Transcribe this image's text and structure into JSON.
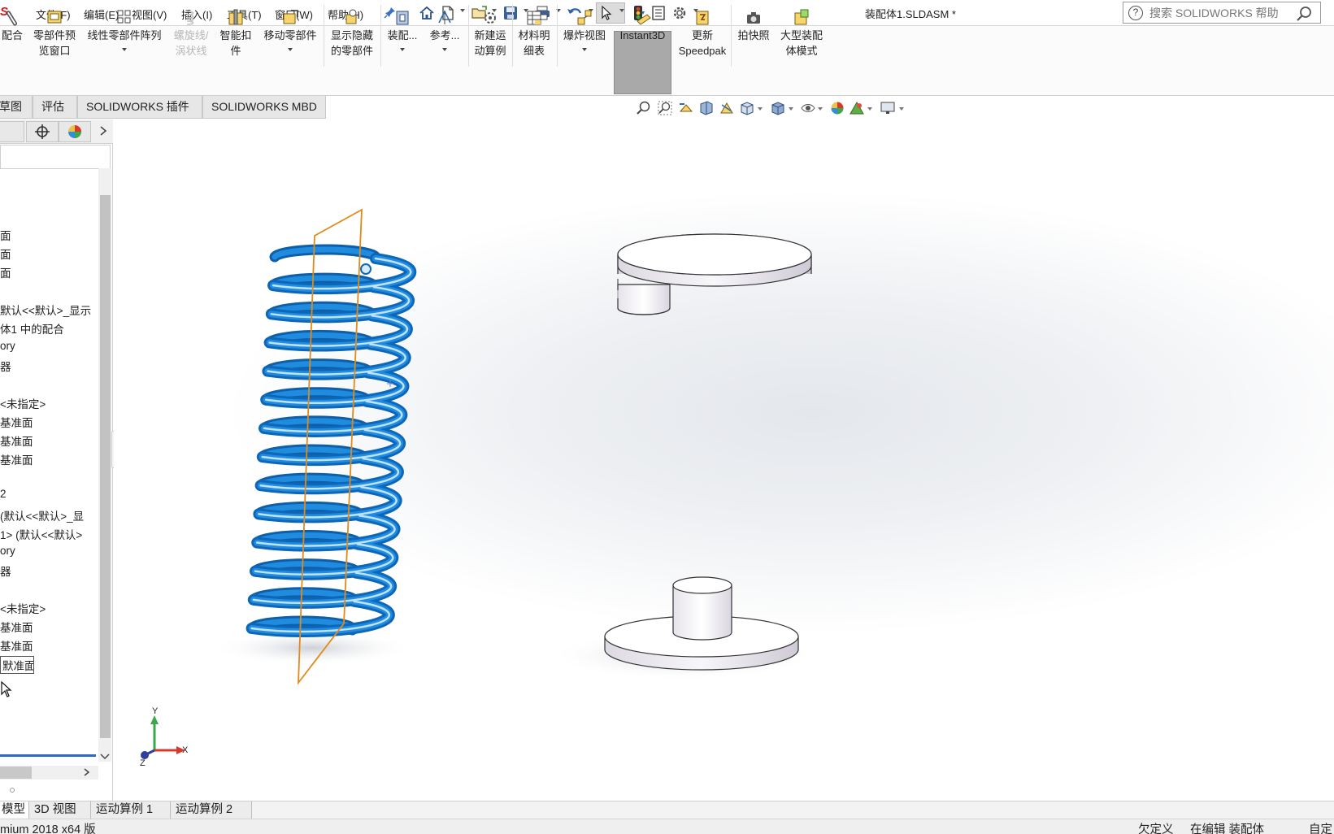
{
  "app": {
    "logo": "S",
    "title": "装配体1.SLDASM *"
  },
  "menu": [
    "文件(F)",
    "编辑(E)",
    "视图(V)",
    "插入(I)",
    "工具(T)",
    "窗口(W)",
    "帮助(H)"
  ],
  "help_search": {
    "placeholder": "搜索 SOLIDWORKS 帮助"
  },
  "ribbon": {
    "mate": "配合",
    "preview_1": "零部件预",
    "preview_2": "览窗口",
    "linear_pattern": "线性零部件阵列",
    "helix_1": "螺旋线/",
    "helix_2": "涡状线",
    "smart_1": "智能扣",
    "smart_2": "件",
    "move": "移动零部件",
    "show_hidden_1": "显示隐藏",
    "show_hidden_2": "的零部件",
    "assembly": "装配...",
    "reference": "参考...",
    "motion_1": "新建运",
    "motion_2": "动算例",
    "bom_1": "材料明",
    "bom_2": "细表",
    "explode": "爆炸视图",
    "instant3d": "Instant3D",
    "speedpak_1": "更新",
    "speedpak_2": "Speedpak",
    "snapshot": "拍快照",
    "large_1": "大型装配",
    "large_2": "体模式"
  },
  "tabs": [
    "草图",
    "评估",
    "SOLIDWORKS 插件",
    "SOLIDWORKS MBD"
  ],
  "tree": [
    "面",
    "面",
    "面",
    "默认<<默认>_显示",
    "体1 中的配合",
    "ory",
    "器",
    "<未指定>",
    "基准面",
    "基准面",
    "基准面",
    "2",
    "(默认<<默认>_显",
    "1> (默认<<默认>",
    "ory",
    "器",
    "<未指定>",
    "基准面",
    "基准面",
    "默准面"
  ],
  "triad": {
    "x": "X",
    "y": "Y",
    "z": "Z"
  },
  "bottom_tabs": [
    "模型",
    "3D 视图",
    "运动算例 1",
    "运动算例 2"
  ],
  "status": {
    "product": "mium 2018 x64 版",
    "defined": "欠定义",
    "editing": "在编辑 装配体",
    "custom": "自定"
  },
  "colors": {
    "spring": "#1f8ce0",
    "plane": "#e08a1a",
    "instant3d_bg": "#a9a9a9",
    "tree_bar": "#2d6bc2"
  }
}
